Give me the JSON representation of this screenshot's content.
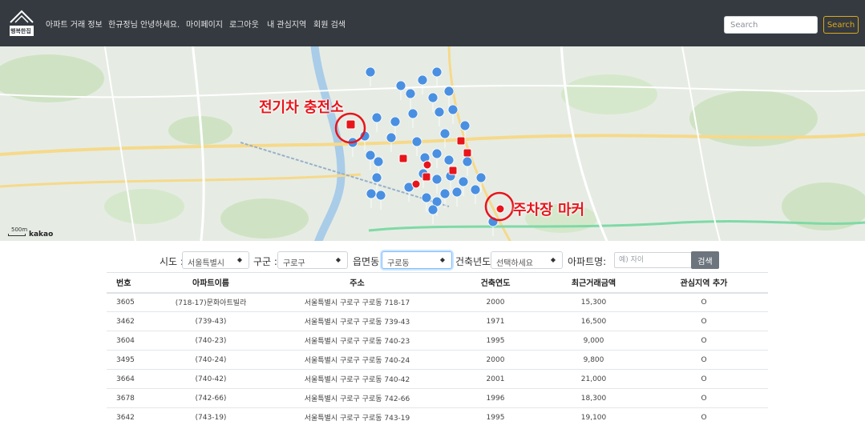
{
  "navbar": {
    "brand_text": "행복한집",
    "links": [
      {
        "label": "아파트 거래 정보"
      },
      {
        "label": "한규정님 안녕하세요."
      },
      {
        "label": "마이페이지"
      },
      {
        "label": "로그아웃"
      },
      {
        "label": "내 관심지역"
      },
      {
        "label": "회원 검색"
      }
    ],
    "search_placeholder": "Search",
    "search_button": "Search"
  },
  "map": {
    "provider": "kakao",
    "scale_text": "500m",
    "annotations": {
      "ev_charger": "전기차 충전소",
      "parking_marker": "주차장 마커"
    },
    "colors": {
      "pin": "#4a90e2",
      "ev_marker": "#e8141b",
      "annotation": "#e8141b"
    }
  },
  "filters": {
    "sido_label": "시도 :",
    "sido_value": "서울특별시",
    "gugun_label": "구군 :",
    "gugun_value": "구로구",
    "dong_label": "읍면동 :",
    "dong_value": "구로동",
    "year_label": "건축년도:",
    "year_value": "선택하세요",
    "apt_label": "아파트명:",
    "apt_placeholder": "예) 자이",
    "search_button": "검색"
  },
  "table": {
    "headers": [
      "번호",
      "아파트이름",
      "주소",
      "건축연도",
      "최근거래금액",
      "관심지역 추가"
    ],
    "rows": [
      {
        "no": "3605",
        "name": "(718-17)문화아트빌라",
        "address": "서울특별시 구로구 구로동 718-17",
        "year": "2000",
        "price": "15,300",
        "fav": "O"
      },
      {
        "no": "3462",
        "name": "(739-43)",
        "address": "서울특별시 구로구 구로동 739-43",
        "year": "1971",
        "price": "16,500",
        "fav": "O"
      },
      {
        "no": "3604",
        "name": "(740-23)",
        "address": "서울특별시 구로구 구로동 740-23",
        "year": "1995",
        "price": "9,000",
        "fav": "O"
      },
      {
        "no": "3495",
        "name": "(740-24)",
        "address": "서울특별시 구로구 구로동 740-24",
        "year": "2000",
        "price": "9,800",
        "fav": "O"
      },
      {
        "no": "3664",
        "name": "(740-42)",
        "address": "서울특별시 구로구 구로동 740-42",
        "year": "2001",
        "price": "21,000",
        "fav": "O"
      },
      {
        "no": "3678",
        "name": "(742-66)",
        "address": "서울특별시 구로구 구로동 742-66",
        "year": "1996",
        "price": "18,300",
        "fav": "O"
      },
      {
        "no": "3642",
        "name": "(743-19)",
        "address": "서울특별시 구로구 구로동 743-19",
        "year": "1995",
        "price": "19,100",
        "fav": "O"
      }
    ]
  }
}
